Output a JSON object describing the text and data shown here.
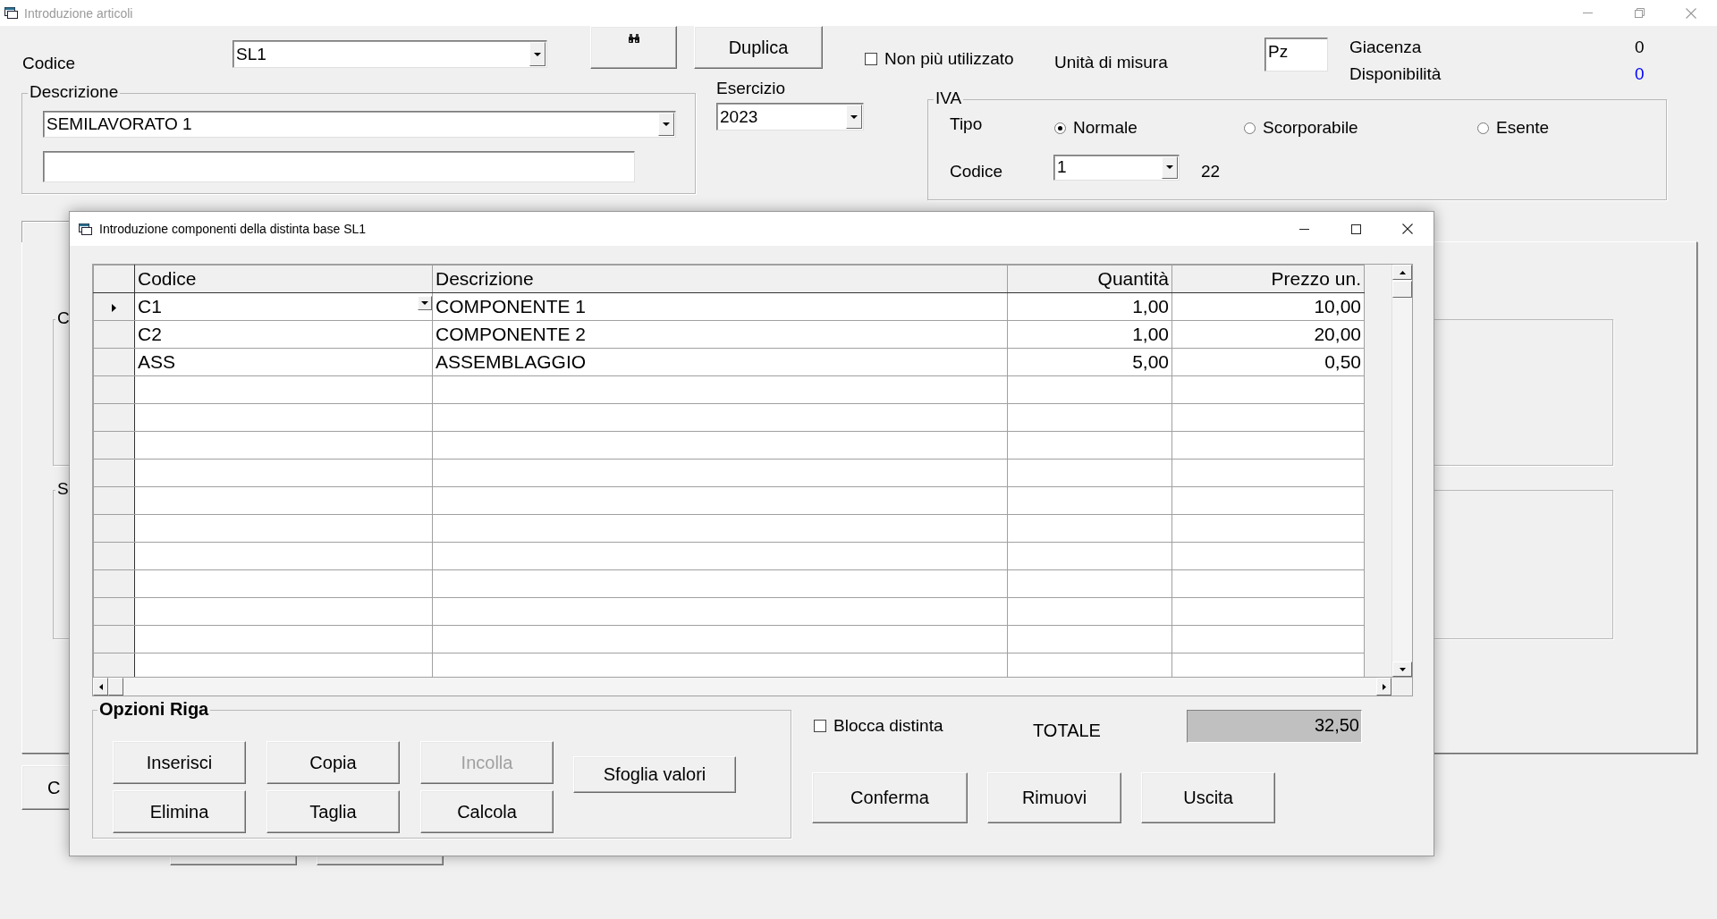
{
  "window": {
    "title": "Introduzione articoli"
  },
  "article": {
    "code_label": "Codice",
    "code": "SL1",
    "duplicate_button": "Duplica",
    "discontinued": {
      "label": "Non più utilizzato",
      "checked": false
    },
    "unit_label": "Unità di misura",
    "unit": "Pz",
    "stock": [
      {
        "label": "Giacenza",
        "value": "0",
        "color": "#000000"
      },
      {
        "label": "Disponibilità",
        "value": "0",
        "color": "#0000ff"
      }
    ],
    "description_group": "Descrizione",
    "description": "SEMILAVORATO 1",
    "year_label": "Esercizio",
    "year": "2023",
    "vat": {
      "title": "IVA",
      "type_label": "Tipo",
      "types": [
        {
          "label": "Normale",
          "selected": true
        },
        {
          "label": "Scorporabile",
          "selected": false
        },
        {
          "label": "Esente",
          "selected": false
        }
      ],
      "code_label": "Codice",
      "code": "1",
      "rate": "22"
    },
    "group_labels": [
      "C",
      "S"
    ],
    "lower_button": "C"
  },
  "dialog": {
    "title": "Introduzione componenti della distinta base SL1",
    "columns": [
      {
        "label": "Codice",
        "numeric": false
      },
      {
        "label": "Descrizione",
        "numeric": false
      },
      {
        "label": "Quantità",
        "numeric": true
      },
      {
        "label": "Prezzo un.",
        "numeric": true
      }
    ],
    "rows": [
      {
        "current": true,
        "cells": [
          "C1",
          "COMPONENTE 1",
          "1,00",
          "10,00"
        ]
      },
      {
        "current": false,
        "cells": [
          "C2",
          "COMPONENTE 2",
          "1,00",
          "20,00"
        ]
      },
      {
        "current": false,
        "cells": [
          "ASS",
          "ASSEMBLAGGIO",
          "5,00",
          "0,50"
        ]
      }
    ],
    "options": {
      "title": "Opzioni Riga",
      "buttons": [
        {
          "label": "Inserisci",
          "disabled": false
        },
        {
          "label": "Copia",
          "disabled": false
        },
        {
          "label": "Incolla",
          "disabled": true
        },
        {
          "label": "Elimina",
          "disabled": false
        },
        {
          "label": "Taglia",
          "disabled": false
        },
        {
          "label": "Calcola",
          "disabled": false
        }
      ],
      "browse_button": "Sfoglia valori"
    },
    "lock": {
      "label": "Blocca distinta",
      "checked": false
    },
    "total_label": "TOTALE",
    "total": "32,50",
    "actions": [
      "Conferma",
      "Rimuovi",
      "Uscita"
    ]
  }
}
